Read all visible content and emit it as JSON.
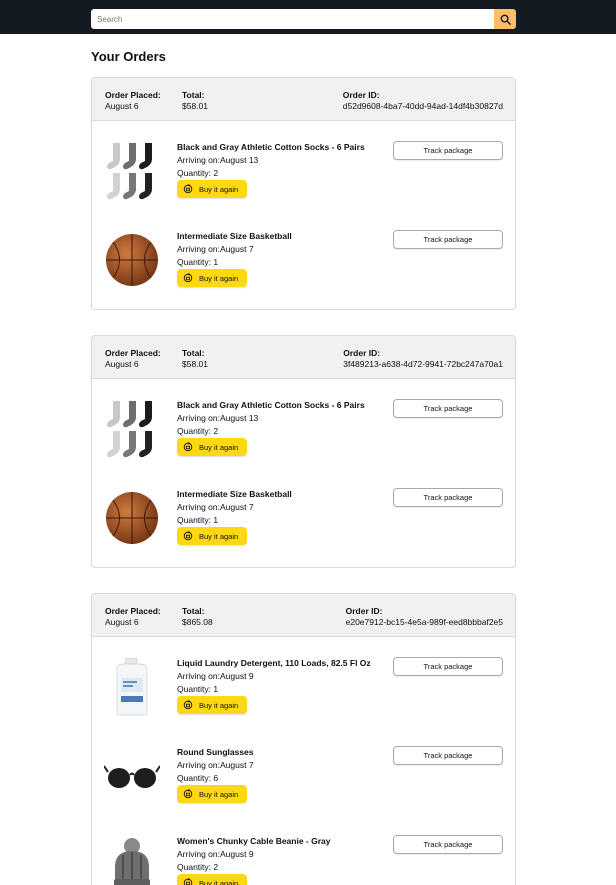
{
  "search": {
    "placeholder": "Search",
    "button_icon": "search-icon"
  },
  "page_title": "Your Orders",
  "labels": {
    "order_placed": "Order Placed:",
    "total": "Total:",
    "order_id": "Order ID:",
    "arriving_prefix": "Arriving on:",
    "quantity_prefix": "Quantity: ",
    "buy_again": "Buy it again",
    "track_package": "Track package"
  },
  "orders": [
    {
      "placed": "August 6",
      "total": "$58.01",
      "order_id": "d52d9608-4ba7-40dd-94ad-14df4b30827d",
      "items": [
        {
          "name": "Black and Gray Athletic Cotton Socks - 6 Pairs",
          "arriving": "August 13",
          "quantity": "2",
          "image": "socks"
        },
        {
          "name": "Intermediate Size Basketball",
          "arriving": "August 7",
          "quantity": "1",
          "image": "basketball"
        }
      ]
    },
    {
      "placed": "August 6",
      "total": "$58.01",
      "order_id": "3f489213-a638-4d72-9941-72bc247a70a1",
      "items": [
        {
          "name": "Black and Gray Athletic Cotton Socks - 6 Pairs",
          "arriving": "August 13",
          "quantity": "2",
          "image": "socks"
        },
        {
          "name": "Intermediate Size Basketball",
          "arriving": "August 7",
          "quantity": "1",
          "image": "basketball"
        }
      ]
    },
    {
      "placed": "August 6",
      "total": "$865.08",
      "order_id": "e20e7912-bc15-4e5a-989f-eed8bbbaf2e5",
      "items": [
        {
          "name": "Liquid Laundry Detergent, 110 Loads, 82.5 Fl Oz",
          "arriving": "August 9",
          "quantity": "1",
          "image": "detergent"
        },
        {
          "name": "Round Sunglasses",
          "arriving": "August 7",
          "quantity": "6",
          "image": "sunglasses"
        },
        {
          "name": "Women's Chunky Cable Beanie - Gray",
          "arriving": "August 9",
          "quantity": "2",
          "image": "beanie"
        }
      ]
    }
  ],
  "colors": {
    "topbar": "#131a22",
    "search_button": "#febd69",
    "buy_button": "#ffd814",
    "header_bg": "#f0f2f2",
    "border": "#d5d9d9"
  }
}
